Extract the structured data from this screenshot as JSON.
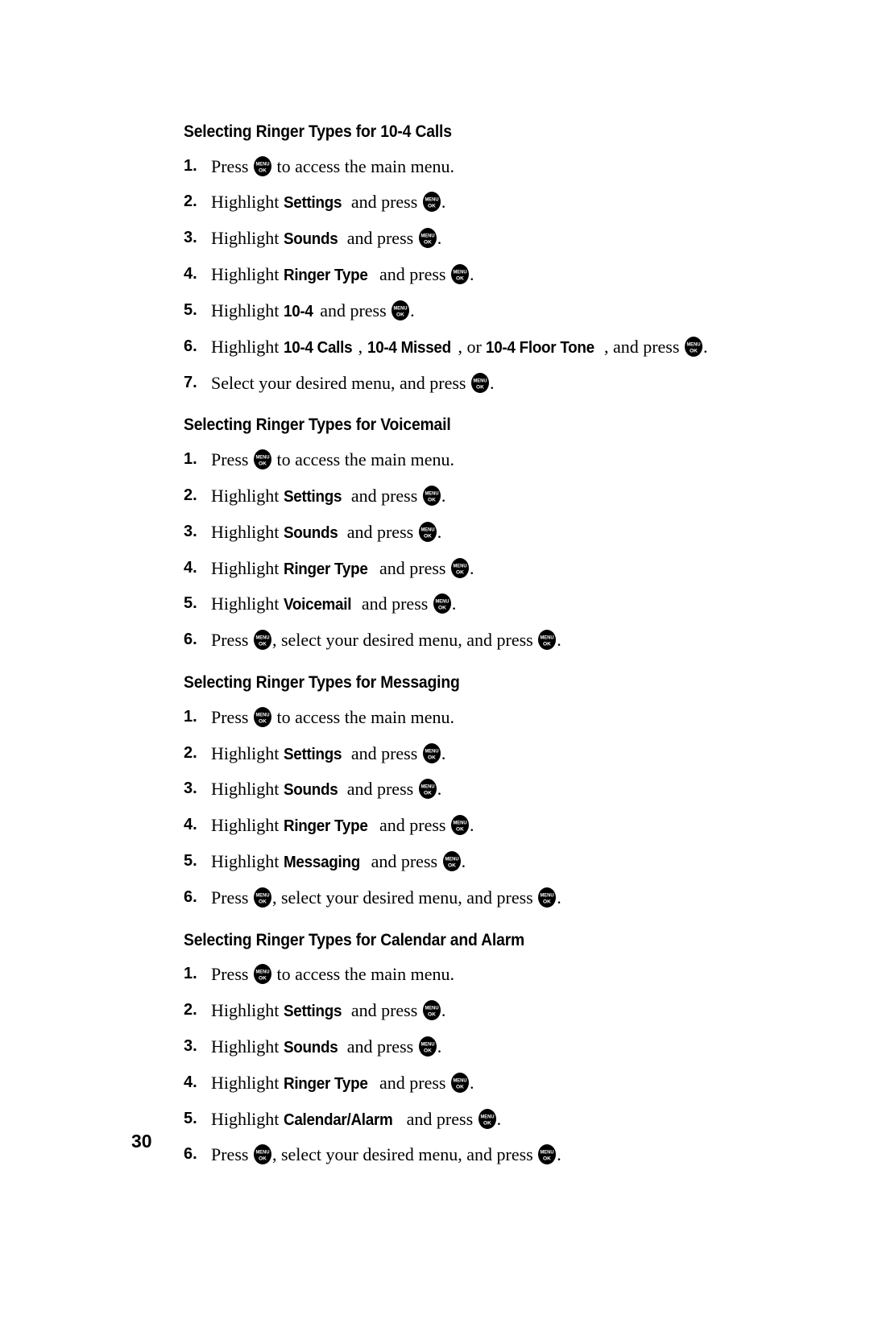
{
  "page": {
    "number": "30",
    "icon_label_top": "MENU",
    "icon_label_bottom": "OK"
  },
  "sections": [
    {
      "heading": "Selecting Ringer Types for 10-4 Calls",
      "steps": [
        {
          "num": "1.",
          "parts": [
            {
              "t": "text",
              "v": "Press "
            },
            {
              "t": "icon"
            },
            {
              "t": "text",
              "v": " to access the main menu."
            }
          ]
        },
        {
          "num": "2.",
          "parts": [
            {
              "t": "text",
              "v": "Highlight "
            },
            {
              "t": "ui",
              "v": "Settings"
            },
            {
              "t": "text",
              "v": " and press "
            },
            {
              "t": "icon"
            },
            {
              "t": "text",
              "v": "."
            }
          ]
        },
        {
          "num": "3.",
          "parts": [
            {
              "t": "text",
              "v": "Highlight "
            },
            {
              "t": "ui",
              "v": "Sounds"
            },
            {
              "t": "text",
              "v": " and press "
            },
            {
              "t": "icon"
            },
            {
              "t": "text",
              "v": "."
            }
          ]
        },
        {
          "num": "4.",
          "parts": [
            {
              "t": "text",
              "v": "Highlight "
            },
            {
              "t": "ui",
              "v": "Ringer Type"
            },
            {
              "t": "text",
              "v": " and press "
            },
            {
              "t": "icon"
            },
            {
              "t": "text",
              "v": "."
            }
          ]
        },
        {
          "num": "5.",
          "parts": [
            {
              "t": "text",
              "v": "Highlight "
            },
            {
              "t": "ui",
              "v": "10-4"
            },
            {
              "t": "text",
              "v": " and press "
            },
            {
              "t": "icon"
            },
            {
              "t": "text",
              "v": "."
            }
          ]
        },
        {
          "num": "6.",
          "parts": [
            {
              "t": "text",
              "v": "Highlight "
            },
            {
              "t": "ui",
              "v": "10-4 Calls"
            },
            {
              "t": "text",
              "v": ", "
            },
            {
              "t": "ui",
              "v": "10-4 Missed"
            },
            {
              "t": "text",
              "v": ", or "
            },
            {
              "t": "ui",
              "v": "10-4 Floor Tone"
            },
            {
              "t": "text",
              "v": ", and press "
            },
            {
              "t": "icon"
            },
            {
              "t": "text",
              "v": "."
            }
          ]
        },
        {
          "num": "7.",
          "parts": [
            {
              "t": "text",
              "v": "Select your desired menu, and press "
            },
            {
              "t": "icon"
            },
            {
              "t": "text",
              "v": "."
            }
          ]
        }
      ]
    },
    {
      "heading": "Selecting Ringer Types for Voicemail",
      "steps": [
        {
          "num": "1.",
          "parts": [
            {
              "t": "text",
              "v": "Press "
            },
            {
              "t": "icon"
            },
            {
              "t": "text",
              "v": " to access the main menu."
            }
          ]
        },
        {
          "num": "2.",
          "parts": [
            {
              "t": "text",
              "v": "Highlight "
            },
            {
              "t": "ui",
              "v": "Settings"
            },
            {
              "t": "text",
              "v": " and press "
            },
            {
              "t": "icon"
            },
            {
              "t": "text",
              "v": "."
            }
          ]
        },
        {
          "num": "3.",
          "parts": [
            {
              "t": "text",
              "v": "Highlight "
            },
            {
              "t": "ui",
              "v": "Sounds"
            },
            {
              "t": "text",
              "v": " and press "
            },
            {
              "t": "icon"
            },
            {
              "t": "text",
              "v": "."
            }
          ]
        },
        {
          "num": "4.",
          "parts": [
            {
              "t": "text",
              "v": "Highlight "
            },
            {
              "t": "ui",
              "v": "Ringer Type"
            },
            {
              "t": "text",
              "v": " and press "
            },
            {
              "t": "icon"
            },
            {
              "t": "text",
              "v": "."
            }
          ]
        },
        {
          "num": "5.",
          "parts": [
            {
              "t": "text",
              "v": "Highlight "
            },
            {
              "t": "ui",
              "v": "Voicemail"
            },
            {
              "t": "text",
              "v": " and press "
            },
            {
              "t": "icon"
            },
            {
              "t": "text",
              "v": "."
            }
          ]
        },
        {
          "num": "6.",
          "parts": [
            {
              "t": "text",
              "v": "Press "
            },
            {
              "t": "icon"
            },
            {
              "t": "text",
              "v": ", select your desired menu, and press "
            },
            {
              "t": "icon"
            },
            {
              "t": "text",
              "v": "."
            }
          ]
        }
      ]
    },
    {
      "heading": "Selecting Ringer Types for Messaging",
      "steps": [
        {
          "num": "1.",
          "parts": [
            {
              "t": "text",
              "v": "Press "
            },
            {
              "t": "icon"
            },
            {
              "t": "text",
              "v": " to access the main menu."
            }
          ]
        },
        {
          "num": "2.",
          "parts": [
            {
              "t": "text",
              "v": "Highlight "
            },
            {
              "t": "ui",
              "v": "Settings"
            },
            {
              "t": "text",
              "v": " and press "
            },
            {
              "t": "icon"
            },
            {
              "t": "text",
              "v": "."
            }
          ]
        },
        {
          "num": "3.",
          "parts": [
            {
              "t": "text",
              "v": "Highlight "
            },
            {
              "t": "ui",
              "v": "Sounds"
            },
            {
              "t": "text",
              "v": " and press "
            },
            {
              "t": "icon"
            },
            {
              "t": "text",
              "v": "."
            }
          ]
        },
        {
          "num": "4.",
          "parts": [
            {
              "t": "text",
              "v": "Highlight "
            },
            {
              "t": "ui",
              "v": "Ringer Type"
            },
            {
              "t": "text",
              "v": " and press "
            },
            {
              "t": "icon"
            },
            {
              "t": "text",
              "v": "."
            }
          ]
        },
        {
          "num": "5.",
          "parts": [
            {
              "t": "text",
              "v": "Highlight "
            },
            {
              "t": "ui",
              "v": "Messaging"
            },
            {
              "t": "text",
              "v": " and press "
            },
            {
              "t": "icon"
            },
            {
              "t": "text",
              "v": "."
            }
          ]
        },
        {
          "num": "6.",
          "parts": [
            {
              "t": "text",
              "v": "Press "
            },
            {
              "t": "icon"
            },
            {
              "t": "text",
              "v": ", select your desired menu, and press "
            },
            {
              "t": "icon"
            },
            {
              "t": "text",
              "v": "."
            }
          ]
        }
      ]
    },
    {
      "heading": "Selecting Ringer Types for Calendar and Alarm",
      "steps": [
        {
          "num": "1.",
          "parts": [
            {
              "t": "text",
              "v": "Press "
            },
            {
              "t": "icon"
            },
            {
              "t": "text",
              "v": " to access the main menu."
            }
          ]
        },
        {
          "num": "2.",
          "parts": [
            {
              "t": "text",
              "v": "Highlight "
            },
            {
              "t": "ui",
              "v": "Settings"
            },
            {
              "t": "text",
              "v": " and press "
            },
            {
              "t": "icon"
            },
            {
              "t": "text",
              "v": "."
            }
          ]
        },
        {
          "num": "3.",
          "parts": [
            {
              "t": "text",
              "v": "Highlight "
            },
            {
              "t": "ui",
              "v": "Sounds"
            },
            {
              "t": "text",
              "v": " and press "
            },
            {
              "t": "icon"
            },
            {
              "t": "text",
              "v": "."
            }
          ]
        },
        {
          "num": "4.",
          "parts": [
            {
              "t": "text",
              "v": "Highlight "
            },
            {
              "t": "ui",
              "v": "Ringer Type"
            },
            {
              "t": "text",
              "v": " and press "
            },
            {
              "t": "icon"
            },
            {
              "t": "text",
              "v": "."
            }
          ]
        },
        {
          "num": "5.",
          "parts": [
            {
              "t": "text",
              "v": "Highlight "
            },
            {
              "t": "ui",
              "v": "Calendar/Alarm"
            },
            {
              "t": "text",
              "v": " and press "
            },
            {
              "t": "icon"
            },
            {
              "t": "text",
              "v": "."
            }
          ]
        },
        {
          "num": "6.",
          "parts": [
            {
              "t": "text",
              "v": "Press "
            },
            {
              "t": "icon"
            },
            {
              "t": "text",
              "v": ", select your desired menu, and press "
            },
            {
              "t": "icon"
            },
            {
              "t": "text",
              "v": "."
            }
          ]
        }
      ]
    }
  ]
}
